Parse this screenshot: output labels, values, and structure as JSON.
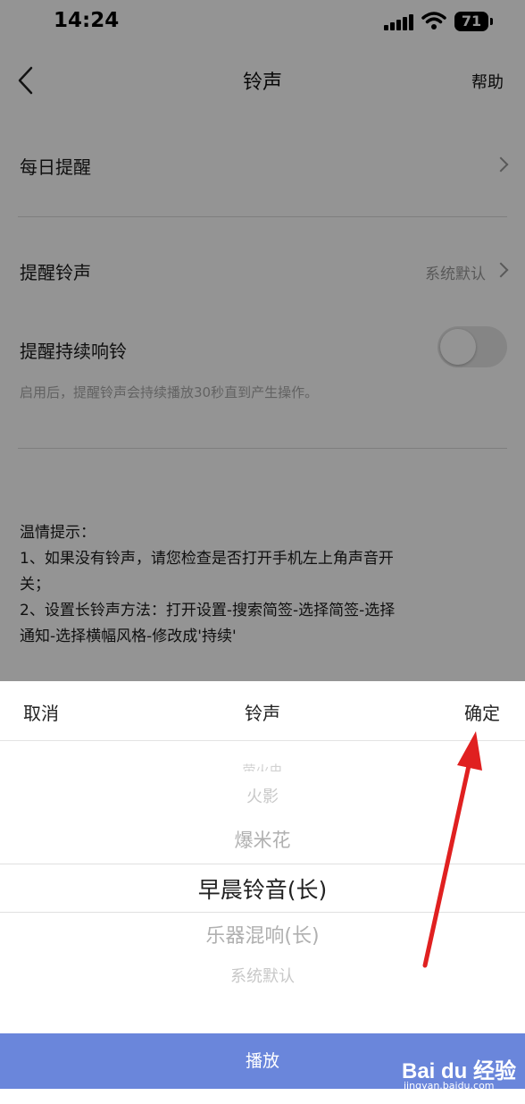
{
  "status_bar": {
    "time": "14:24",
    "battery": "71"
  },
  "nav": {
    "title": "铃声",
    "help": "帮助"
  },
  "settings": {
    "daily_reminder": "每日提醒",
    "reminder_ringtone": "提醒铃声",
    "reminder_ringtone_value": "系统默认",
    "continuous_ring": "提醒持续响铃",
    "continuous_ring_enabled": false,
    "continuous_hint": "启用后，提醒铃声会持续播放30秒直到产生操作。"
  },
  "tips": {
    "title": "温情提示：",
    "line1": "1、如果没有铃声，请您检查是否打开手机左上角声音开",
    "line2": "关；",
    "line3": "2、设置长铃声方法：打开设置-搜索简签-选择简签-选择",
    "line4": "通知-选择横幅风格-修改成'持续'"
  },
  "sheet": {
    "cancel": "取消",
    "title": "铃声",
    "confirm": "确定",
    "options": [
      "萤火虫",
      "火影",
      "爆米花",
      "早晨铃音(长)",
      "乐器混响(长)",
      "系统默认"
    ],
    "selected": "早晨铃音(长)",
    "play": "播放"
  },
  "watermark": {
    "logo": "Bai du 经验",
    "url": "jingyan.baidu.com"
  },
  "colors": {
    "play_bar": "#6a86db",
    "annotation_arrow": "#e02020"
  }
}
